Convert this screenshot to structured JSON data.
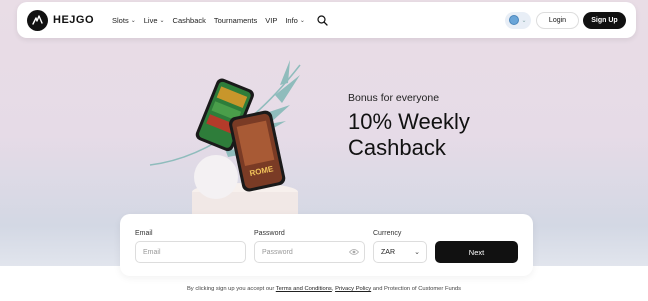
{
  "brand": {
    "name": "HEJGO"
  },
  "nav": {
    "items": [
      {
        "label": "Slots",
        "has_dropdown": true
      },
      {
        "label": "Live",
        "has_dropdown": true
      },
      {
        "label": "Cashback",
        "has_dropdown": false
      },
      {
        "label": "Tournaments",
        "has_dropdown": false
      },
      {
        "label": "VIP",
        "has_dropdown": false
      },
      {
        "label": "Info",
        "has_dropdown": true
      }
    ],
    "chevron": "⌄",
    "search_icon": "search-icon",
    "language_icon": "globe-icon",
    "login_label": "Login",
    "signup_label": "Sign Up"
  },
  "hero": {
    "subtitle": "Bonus for everyone",
    "title_line1": "10% Weekly",
    "title_line2": "Cashback",
    "phone_caption": "ROME"
  },
  "form": {
    "email_label": "Email",
    "email_placeholder": "Email",
    "password_label": "Password",
    "password_placeholder": "Password",
    "currency_label": "Currency",
    "currency_value": "ZAR",
    "next_label": "Next"
  },
  "disclaimer": {
    "prefix": "By clicking sign up you accept our ",
    "terms": "Terms and Conditions",
    "sep": ", ",
    "privacy": "Privacy Policy",
    "suffix": " and Protection of Customer Funds"
  },
  "colors": {
    "primary_button": "#111111",
    "accent_teal": "#8fbcbc",
    "background_pink": "#e9dde6"
  }
}
